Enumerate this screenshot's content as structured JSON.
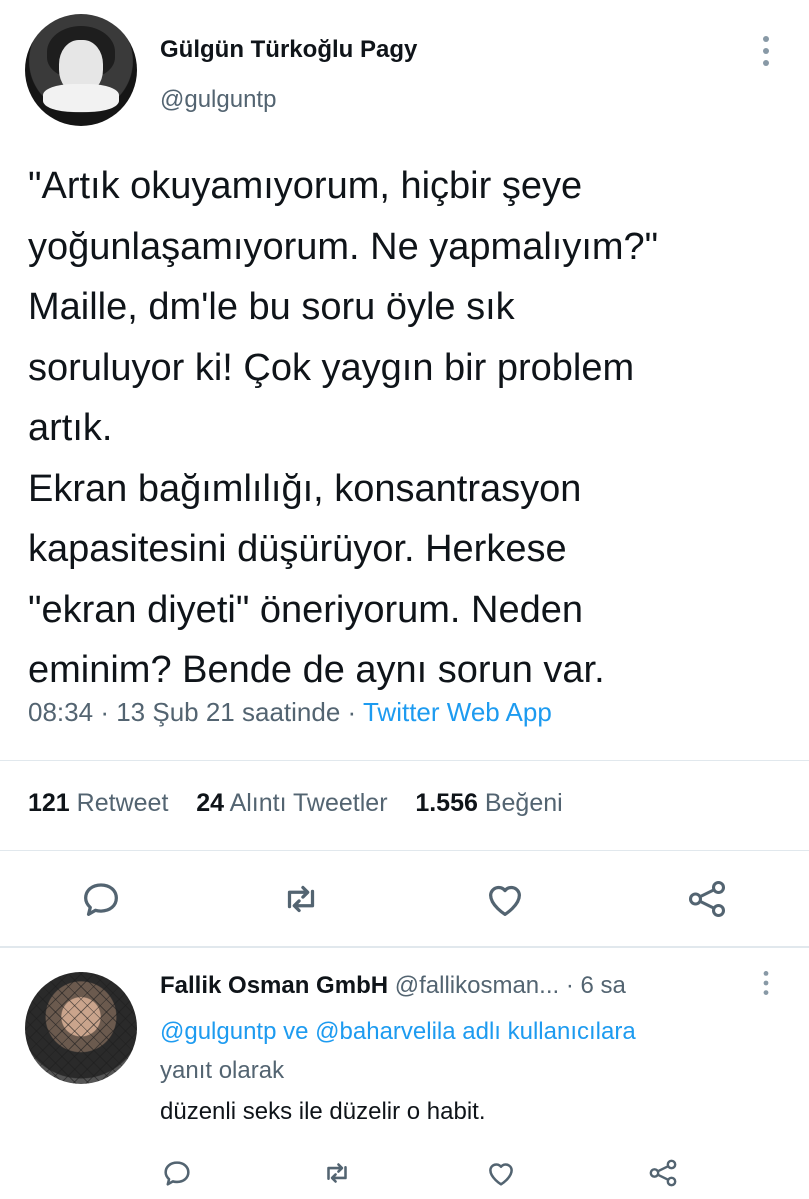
{
  "tweet": {
    "author_name": "Gülgün Türkoğlu Pagy",
    "author_handle": "@gulguntp",
    "text": "\"Artık okuyamıyorum, hiçbir şeye\nyoğunlaşamıyorum. Ne yapmalıyım?\"\nMaille, dm'le bu soru öyle sık\nsoruluyor ki! Çok yaygın bir problem\nartık.\nEkran bağımlılığı, konsantrasyon\nkapasitesini düşürüyor. Herkese\n\"ekran diyeti\" öneriyorum. Neden\neminim? Bende de aynı sorun var.",
    "time": "08:34",
    "date": "13 Şub 21 saatinde",
    "source": "Twitter Web App",
    "separator": "·",
    "stats": {
      "retweets_count": "121",
      "retweets_label": "Retweet",
      "quotes_count": "24",
      "quotes_label": "Alıntı Tweetler",
      "likes_count": "1.556",
      "likes_label": "Beğeni"
    }
  },
  "reply": {
    "author_name": "Fallik Osman GmbH",
    "author_handle": "@fallikosman...",
    "separator": "·",
    "time_ago": "6 sa",
    "mention_1": "@gulguntp",
    "connector": "ve",
    "mention_2": "@baharvelila",
    "reply_suffix_1": "adlı kullanıcılara",
    "reply_suffix_2": "yanıt olarak",
    "text": "düzenli seks ile düzelir o habit."
  },
  "icons": [
    "more-vertical-icon",
    "reply-icon",
    "retweet-icon",
    "like-icon",
    "share-icon"
  ],
  "colors": {
    "accent": "#1d9bf0",
    "text": "#0f1419",
    "muted": "#536471",
    "divider": "#e1e8ed"
  }
}
